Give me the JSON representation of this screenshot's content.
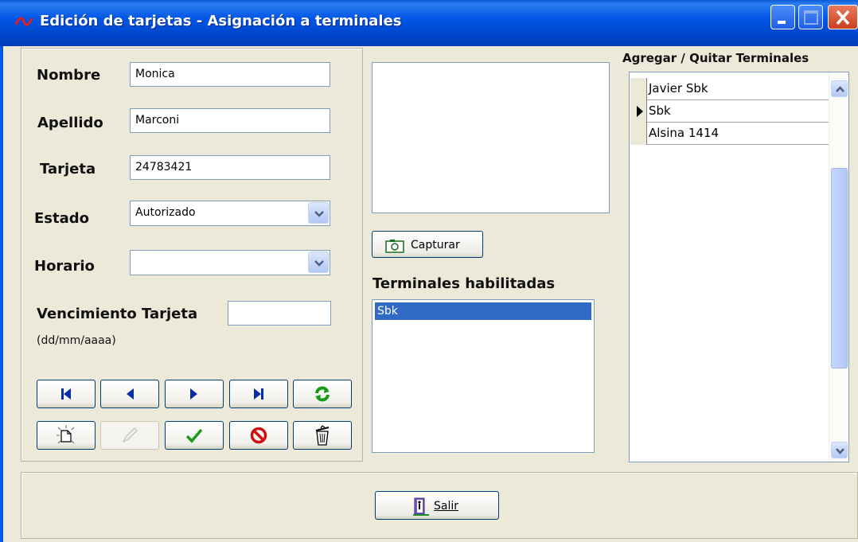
{
  "window": {
    "title": "Edición de tarjetas - Asignación a terminales",
    "controls": [
      "minimize-icon",
      "maximize-icon",
      "close-icon"
    ]
  },
  "form": {
    "nombre": {
      "label": "Nombre",
      "value": "Monica"
    },
    "apellido": {
      "label": "Apellido",
      "value": "Marconi"
    },
    "tarjeta": {
      "label": "Tarjeta",
      "value": "24783421"
    },
    "estado": {
      "label": "Estado",
      "selected": "Autorizado"
    },
    "horario": {
      "label": "Horario",
      "selected": ""
    },
    "vencimiento": {
      "label": "Vencimiento Tarjeta",
      "hint": "(dd/mm/aaaa)",
      "value": ""
    }
  },
  "photo": {
    "capture_label": "Capturar",
    "capture_icon": "camera-icon"
  },
  "terminales_habilitadas": {
    "title": "Terminales habilitadas",
    "items": [
      "Sbk"
    ]
  },
  "agregar_quitar": {
    "title": "Agregar / Quitar Terminales",
    "rows": [
      {
        "name": "Javier Sbk",
        "current": false
      },
      {
        "name": "Sbk",
        "current": true
      },
      {
        "name": "Alsina 1414",
        "current": false
      }
    ]
  },
  "navigation": {
    "row1": [
      "first-record-icon",
      "previous-record-icon",
      "next-record-icon",
      "last-record-icon",
      "refresh-icon"
    ],
    "row2": [
      "new-record-icon",
      "edit-record-icon",
      "confirm-icon",
      "cancel-icon",
      "delete-icon"
    ]
  },
  "footer": {
    "salir_label": "Salir",
    "salir_icon": "exit-door-icon"
  },
  "colors": {
    "titlebar": "#0055e5",
    "selection": "#316ac5",
    "window_bg": "#ece9d8"
  }
}
